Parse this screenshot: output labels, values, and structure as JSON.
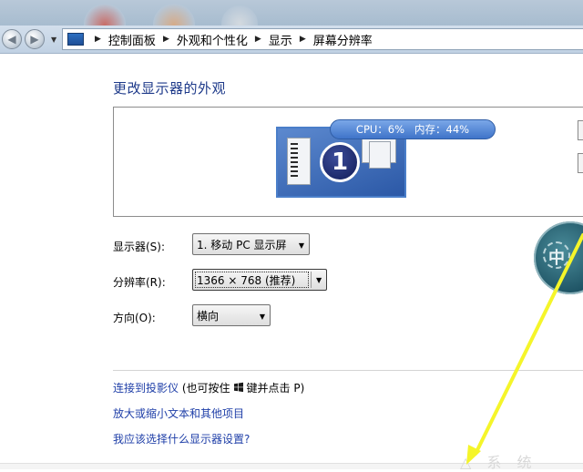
{
  "breadcrumb": {
    "items": [
      "控制面板",
      "外观和个性化",
      "显示",
      "屏幕分辨率"
    ]
  },
  "heading": "更改显示器的外观",
  "preview": {
    "monitor_number": "1"
  },
  "perf_overlay": {
    "text": "CPU：6%   内存：44%"
  },
  "settings": {
    "display": {
      "label": "显示器(S):",
      "value": "1. 移动 PC 显示屏"
    },
    "resolution": {
      "label": "分辨率(R):",
      "value": "1366 × 768 (推荐)"
    },
    "orientation": {
      "label": "方向(O):",
      "value": "横向"
    }
  },
  "links": {
    "projector_link": "连接到投影仪",
    "projector_hint_prefix": "(也可按住",
    "projector_hint_suffix": "键并点击 P)",
    "text_size": "放大或缩小文本和其他项目",
    "which_settings": "我应该选择什么显示器设置?"
  },
  "gadget": {
    "text": "中"
  },
  "watermark": {
    "text": "△ 系 统"
  },
  "colors": {
    "link": "#1f3fa8",
    "heading": "#1e3a8a",
    "arrow": "#f5f52a",
    "cpu_pill": "#4a7fd0"
  },
  "icons": {
    "back": "back-arrow-icon",
    "forward": "forward-arrow-icon",
    "control_panel": "control-panel-icon",
    "windows_key": "windows-logo-icon"
  }
}
